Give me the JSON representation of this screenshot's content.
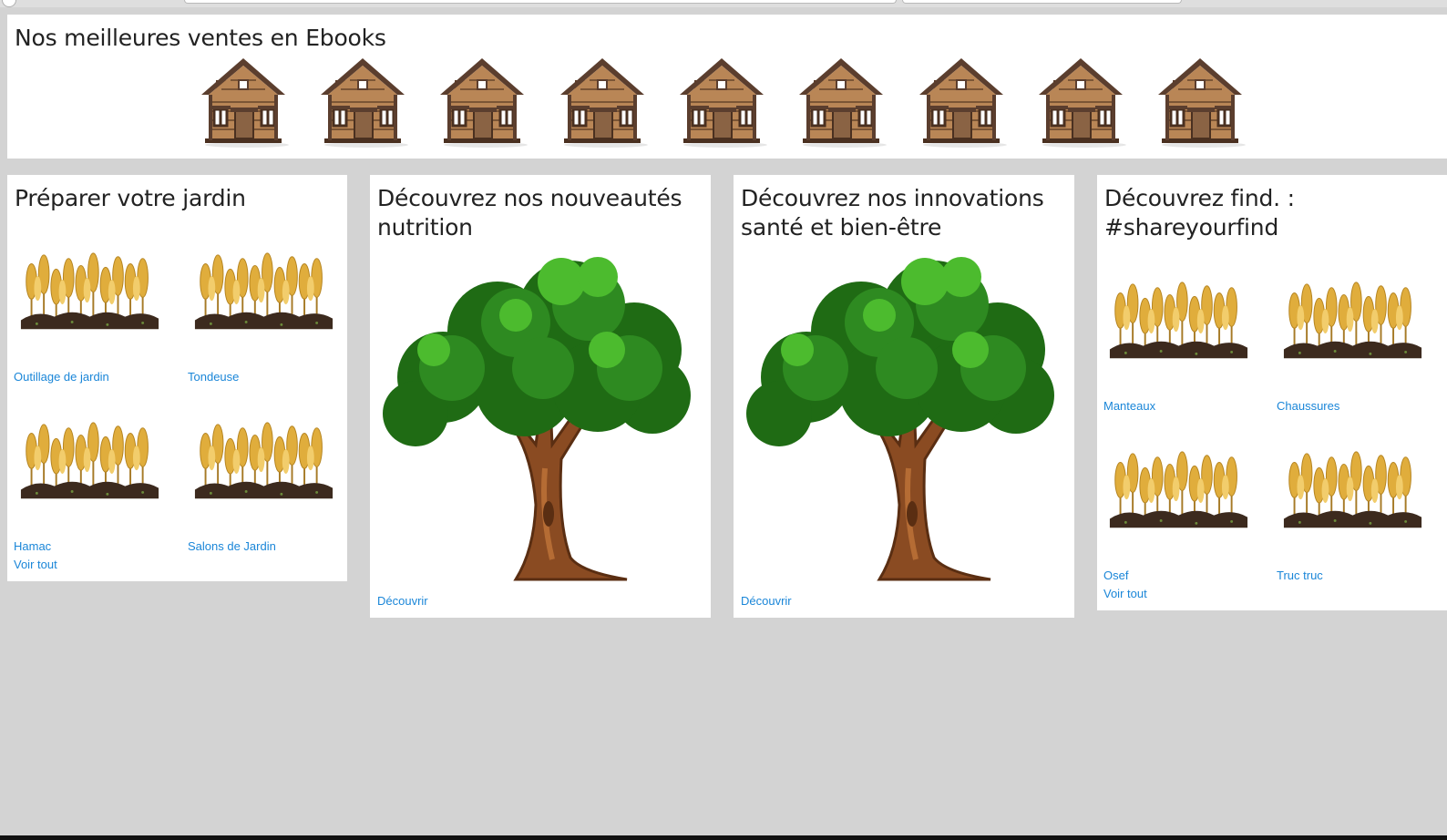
{
  "ebooks": {
    "title": "Nos meilleures ventes en Ebooks",
    "items": [
      "house-icon",
      "house-icon",
      "house-icon",
      "house-icon",
      "house-icon",
      "house-icon",
      "house-icon",
      "house-icon",
      "house-icon"
    ]
  },
  "jardin": {
    "title": "Préparer votre jardin",
    "items": [
      {
        "label": "Outillage de jardin",
        "icon": "wheat-field-icon"
      },
      {
        "label": "Tondeuse",
        "icon": "wheat-field-icon"
      },
      {
        "label": "Hamac",
        "icon": "wheat-field-icon"
      },
      {
        "label": "Salons de Jardin",
        "icon": "wheat-field-icon"
      }
    ],
    "see_all": "Voir tout"
  },
  "nutrition": {
    "title": "Découvrez nos nouveautés nutrition",
    "icon": "tree-icon",
    "link": "Découvrir"
  },
  "sante": {
    "title": "Découvrez nos innovations santé et bien-être",
    "icon": "tree-icon",
    "link": "Découvrir"
  },
  "find": {
    "title": "Découvrez find. : #shareyourfind",
    "items": [
      {
        "label": "Manteaux",
        "icon": "wheat-field-icon"
      },
      {
        "label": "Chaussures",
        "icon": "wheat-field-icon"
      },
      {
        "label": "Osef",
        "icon": "wheat-field-icon"
      },
      {
        "label": "Truc truc",
        "icon": "wheat-field-icon"
      }
    ],
    "see_all": "Voir tout"
  },
  "colors": {
    "background": "#d3d3d3",
    "panel": "#ffffff",
    "link": "#1a86d8",
    "title_text": "#222222"
  }
}
